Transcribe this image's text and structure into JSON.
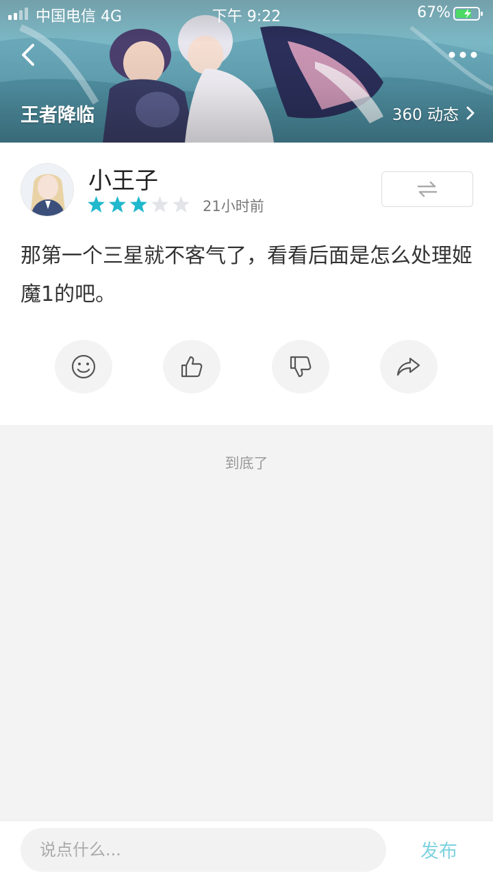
{
  "status_bar": {
    "carrier": "中国电信",
    "network": "4G",
    "time": "下午 9:22",
    "battery": "67%"
  },
  "header": {
    "title": "王者降临",
    "dynamics": "360 动态",
    "back_icon": "chevron-left-icon",
    "more_icon": "more-dots-icon"
  },
  "post": {
    "username": "小王子",
    "rating": 3,
    "rating_max": 5,
    "time": "21小时前",
    "content": "那第一个三星就不客气了，看看后面是怎么处理姬魔1的吧。",
    "actions": [
      {
        "name": "emoji",
        "icon": "smiley-icon"
      },
      {
        "name": "like",
        "icon": "thumbs-up-icon"
      },
      {
        "name": "dislike",
        "icon": "thumbs-down-icon"
      },
      {
        "name": "share",
        "icon": "share-icon"
      }
    ]
  },
  "footer_text": "到底了",
  "comment_bar": {
    "placeholder": "说点什么...",
    "publish": "发布"
  },
  "colors": {
    "star_active": "#1fb8cc",
    "star_inactive": "#e2e4e8",
    "publish": "#7fd3e0"
  }
}
